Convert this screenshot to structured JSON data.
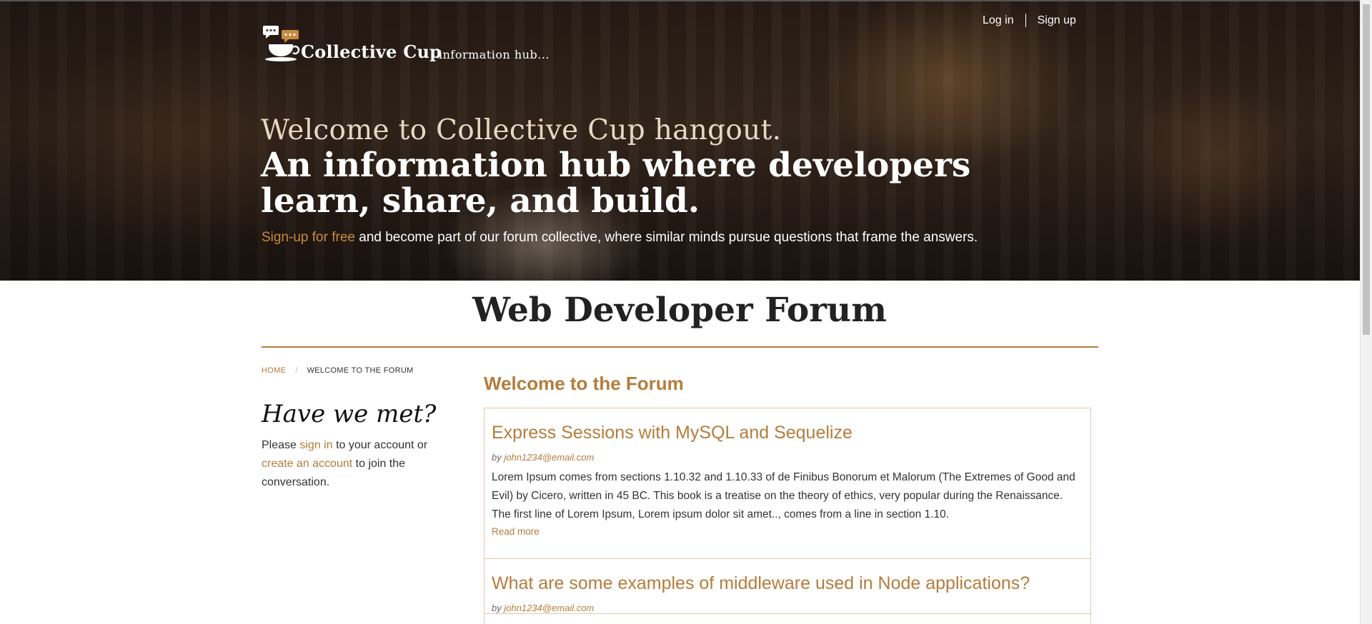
{
  "header": {
    "logo_name": "Collective Cup",
    "logo_sub": "information hub...",
    "login_label": "Log in",
    "signup_label": "Sign up"
  },
  "hero": {
    "welcome": "Welcome to Collective Cup hangout.",
    "headline": "An information hub where developers learn, share, and build.",
    "cta_link": "Sign-up for free",
    "cta_rest": " and become part of our forum collective, where similar minds pursue questions that frame the answers."
  },
  "page": {
    "title": "Web Developer Forum"
  },
  "breadcrumb": {
    "home": "HOME",
    "separator": "/",
    "current": "WELCOME TO THE FORUM"
  },
  "sidebar": {
    "title": "Have we met?",
    "text_1": "Please ",
    "sign_in_link": "sign in",
    "text_2": " to your account or ",
    "create_link": "create an account",
    "text_3": " to join the conversation."
  },
  "main": {
    "heading": "Welcome to the Forum",
    "posts": [
      {
        "title": "Express Sessions with MySQL and Sequelize",
        "by": "by ",
        "author": "john1234@email.com",
        "body": "Lorem Ipsum comes from sections 1.10.32 and 1.10.33 of de Finibus Bonorum et Malorum (The Extremes of Good and Evil) by Cicero, written in 45 BC. This book is a treatise on the theory of ethics, very popular during the Renaissance. The first line of Lorem Ipsum, Lorem ipsum dolor sit amet.., comes from a line in section 1.10.",
        "read_more": "Read more"
      },
      {
        "title": "What are some examples of middleware used in Node applications?",
        "by": "by ",
        "author": "john1234@email.com"
      }
    ]
  },
  "colors": {
    "accent": "#b47c3c",
    "hero_tint": "#3a2a1f"
  }
}
